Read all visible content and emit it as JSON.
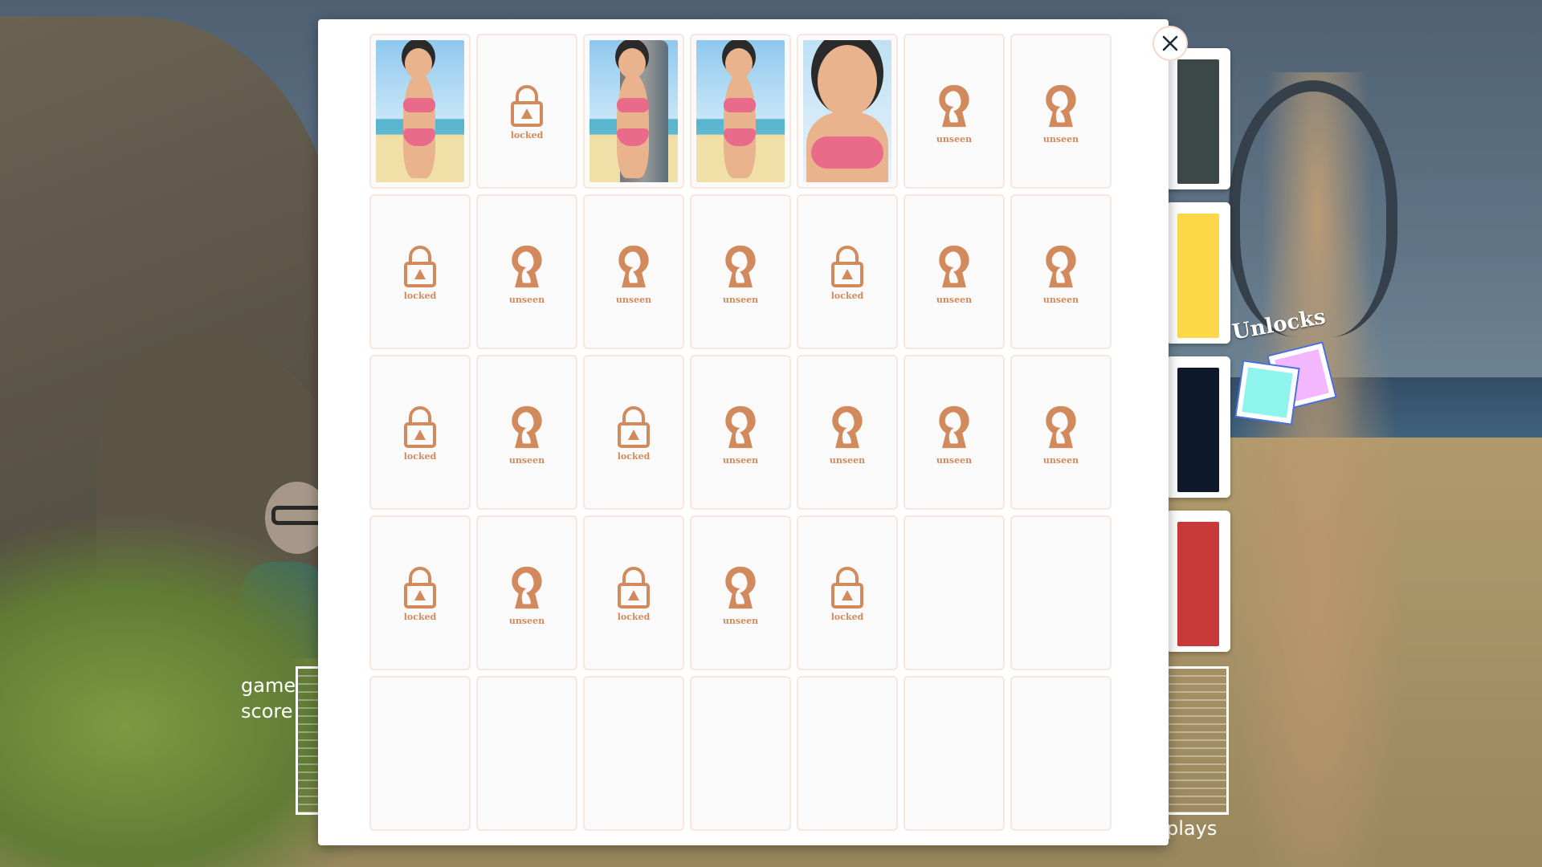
{
  "gallery": {
    "tiles": [
      {
        "state": "image",
        "variant": "back",
        "label": ""
      },
      {
        "state": "locked",
        "label": "locked"
      },
      {
        "state": "image",
        "variant": "rock",
        "label": ""
      },
      {
        "state": "image",
        "variant": "standing",
        "label": ""
      },
      {
        "state": "image",
        "variant": "portrait",
        "label": ""
      },
      {
        "state": "unseen",
        "label": "unseen"
      },
      {
        "state": "unseen",
        "label": "unseen"
      },
      {
        "state": "locked",
        "label": "locked"
      },
      {
        "state": "unseen",
        "label": "unseen"
      },
      {
        "state": "unseen",
        "label": "unseen"
      },
      {
        "state": "unseen",
        "label": "unseen"
      },
      {
        "state": "locked",
        "label": "locked"
      },
      {
        "state": "unseen",
        "label": "unseen"
      },
      {
        "state": "unseen",
        "label": "unseen"
      },
      {
        "state": "locked",
        "label": "locked"
      },
      {
        "state": "unseen",
        "label": "unseen"
      },
      {
        "state": "locked",
        "label": "locked"
      },
      {
        "state": "unseen",
        "label": "unseen"
      },
      {
        "state": "unseen",
        "label": "unseen"
      },
      {
        "state": "unseen",
        "label": "unseen"
      },
      {
        "state": "unseen",
        "label": "unseen"
      },
      {
        "state": "locked",
        "label": "locked"
      },
      {
        "state": "unseen",
        "label": "unseen"
      },
      {
        "state": "locked",
        "label": "locked"
      },
      {
        "state": "unseen",
        "label": "unseen"
      },
      {
        "state": "locked",
        "label": "locked"
      },
      {
        "state": "empty",
        "label": ""
      },
      {
        "state": "empty",
        "label": ""
      },
      {
        "state": "empty",
        "label": ""
      },
      {
        "state": "empty",
        "label": ""
      },
      {
        "state": "empty",
        "label": ""
      },
      {
        "state": "empty",
        "label": ""
      },
      {
        "state": "empty",
        "label": ""
      },
      {
        "state": "empty",
        "label": ""
      },
      {
        "state": "empty",
        "label": ""
      }
    ],
    "icon_color": "#d28a5c"
  },
  "hud": {
    "score_label_line1": "game",
    "score_label_line2": "score",
    "plays_label": "plays",
    "unlocks_label": "Unlocks"
  },
  "swatches": [
    "#3c4747",
    "#fdd94a",
    "#0e1a2b",
    "#c83a3a"
  ],
  "icons": {
    "close": "close-icon",
    "locked": "padlock-icon",
    "unseen": "keyhole-icon"
  }
}
